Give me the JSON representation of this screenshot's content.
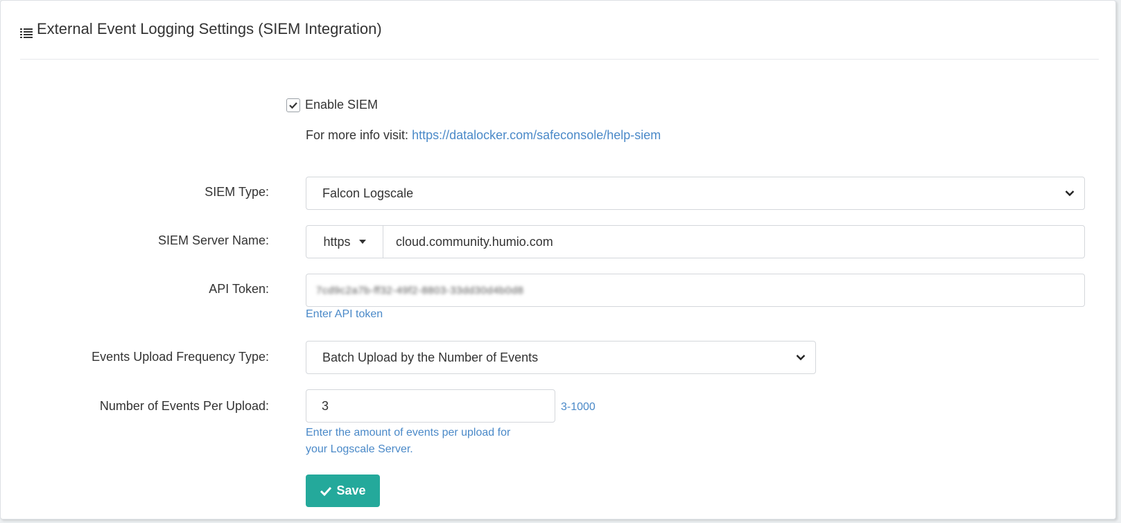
{
  "header": {
    "title": "External Event Logging Settings (SIEM Integration)",
    "icon": "list-icon"
  },
  "enable_siem": {
    "label": "Enable SIEM",
    "checked": true
  },
  "info": {
    "prefix": "For more info visit:",
    "link_text": "https://datalocker.com/safeconsole/help-siem"
  },
  "siem_type": {
    "label": "SIEM Type:",
    "value": "Falcon Logscale"
  },
  "server_name": {
    "label": "SIEM Server Name:",
    "protocol": "https",
    "value": "cloud.community.humio.com"
  },
  "api_token": {
    "label": "API Token:",
    "value": "7cd9c2a7b-ff32-49f2-8803-33dd30d4b0d8",
    "help": "Enter API token"
  },
  "frequency": {
    "label": "Events Upload Frequency Type:",
    "value": "Batch Upload by the Number of Events"
  },
  "events_per_upload": {
    "label": "Number of Events Per Upload:",
    "value": "3",
    "range": "3-1000",
    "help_line1": "Enter the amount of events per upload for",
    "help_line2": "your Logscale Server."
  },
  "save_label": "Save",
  "colors": {
    "accent": "#24a99b",
    "link": "#4a89c8"
  }
}
